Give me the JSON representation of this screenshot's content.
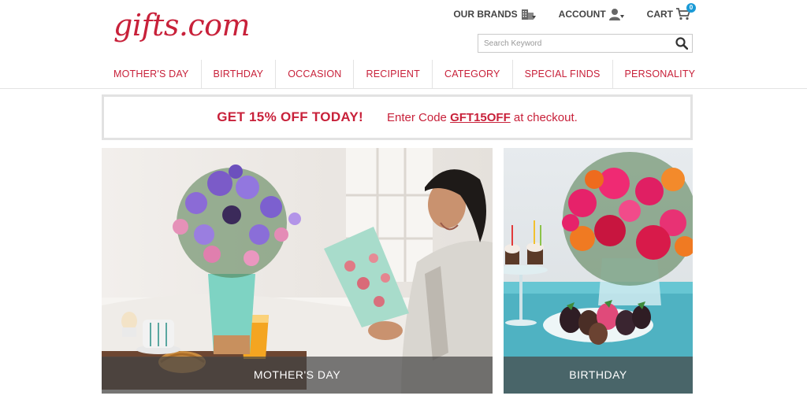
{
  "brand": {
    "logo_text": "gifts.com",
    "accent_color": "#c8213a"
  },
  "utility": {
    "brands_label": "OUR BRANDS",
    "account_label": "ACCOUNT",
    "cart_label": "CART",
    "cart_count": "0"
  },
  "search": {
    "placeholder": "Search Keyword",
    "value": ""
  },
  "nav": {
    "items": [
      {
        "label": "MOTHER'S DAY"
      },
      {
        "label": "BIRTHDAY"
      },
      {
        "label": "OCCASION"
      },
      {
        "label": "RECIPIENT"
      },
      {
        "label": "CATEGORY"
      },
      {
        "label": "SPECIAL FINDS"
      },
      {
        "label": "PERSONALITY"
      }
    ]
  },
  "promo": {
    "headline": "GET 15% OFF TODAY!",
    "text_before": "Enter Code",
    "code": "GFT15OFF",
    "text_after": "at checkout."
  },
  "tiles": [
    {
      "caption": "MOTHER'S DAY",
      "image": "woman-reading-card-with-flowers-breakfast-tray"
    },
    {
      "caption": "BIRTHDAY",
      "image": "bouquet-cupcakes-chocolate-strawberries"
    }
  ]
}
